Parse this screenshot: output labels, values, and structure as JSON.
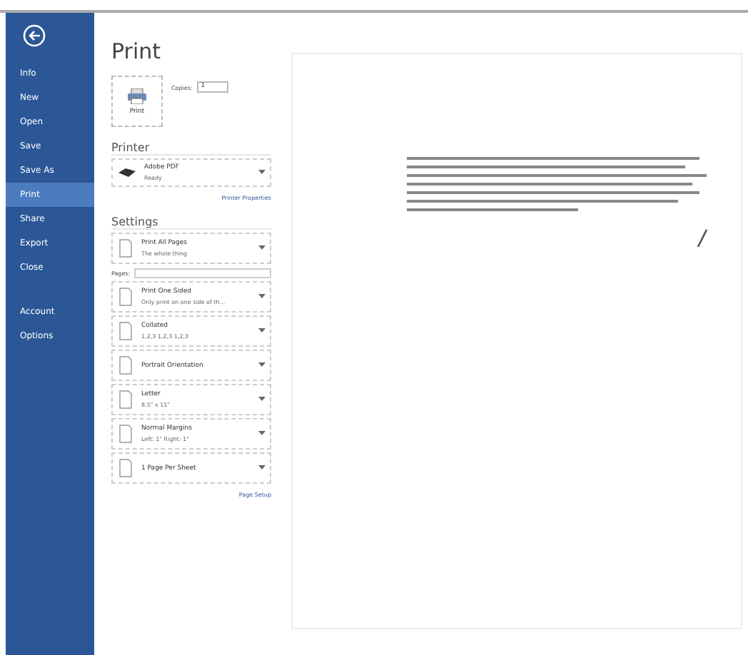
{
  "nav": {
    "items": [
      {
        "label": "Info",
        "selected": false
      },
      {
        "label": "New",
        "selected": false
      },
      {
        "label": "Open",
        "selected": false
      },
      {
        "label": "Save",
        "selected": false
      },
      {
        "label": "Save As",
        "selected": false
      },
      {
        "label": "Print",
        "selected": true
      },
      {
        "label": "Share",
        "selected": false
      },
      {
        "label": "Export",
        "selected": false
      },
      {
        "label": "Close",
        "selected": false
      }
    ],
    "bottom_items": [
      {
        "label": "Account",
        "selected": false
      },
      {
        "label": "Options",
        "selected": false
      }
    ]
  },
  "title": "Print",
  "print_button": {
    "label": "Print"
  },
  "copies": {
    "label": "Copies:",
    "value": "1"
  },
  "printer": {
    "heading": "Printer",
    "name": "Adobe PDF",
    "status": "Ready",
    "properties_link": "Printer Properties"
  },
  "settings": {
    "heading": "Settings",
    "items": [
      {
        "kind": "dropdown",
        "title": "Print All Pages",
        "subtitle": "The whole thing"
      },
      {
        "kind": "field",
        "label": "Pages:"
      },
      {
        "kind": "dropdown",
        "title": "Print One Sided",
        "subtitle": "Only print on one side of th..."
      },
      {
        "kind": "dropdown",
        "title": "Collated",
        "subtitle": "1,2,3   1,2,3   1,2,3"
      },
      {
        "kind": "dropdown",
        "title": "Portrait Orientation"
      },
      {
        "kind": "dropdown",
        "title": "Letter",
        "subtitle": "8.5\" x 11\""
      },
      {
        "kind": "dropdown",
        "title": "Normal Margins",
        "subtitle": "Left: 1\"   Right: 1\""
      },
      {
        "kind": "dropdown",
        "title": "1 Page Per Sheet"
      }
    ],
    "page_setup_link": "Page Setup"
  }
}
